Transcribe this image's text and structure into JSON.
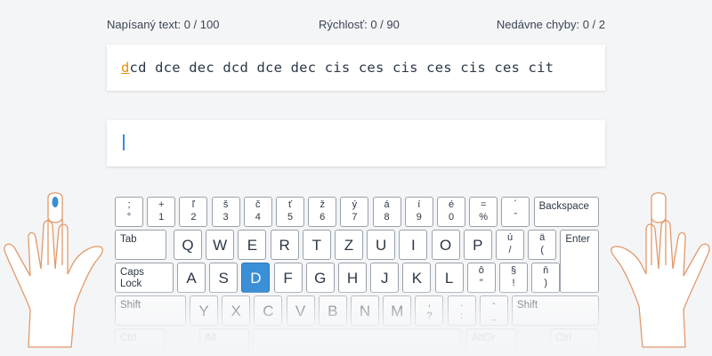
{
  "stats": {
    "typed": "Napísaný text: 0 / 100",
    "speed": "Rýchlosť: 0 / 90",
    "errors": "Nedávne chyby: 0 / 2"
  },
  "lesson": {
    "current_char": "d",
    "remaining_text": "cd dce dec dcd dce dec cis ces cis ces cis ces cit"
  },
  "input": {
    "value": ""
  },
  "colors": {
    "accent": "#3a8fd6",
    "current_char": "#e8930c",
    "finger_highlight": "#3a8fd6"
  },
  "hands": {
    "left_icon": "left-hand-icon",
    "right_icon": "right-hand-icon",
    "active_finger": "left-little"
  },
  "keyboard": {
    "row1": [
      {
        "top": ";",
        "bot": "°"
      },
      {
        "top": "+",
        "bot": "1"
      },
      {
        "top": "ľ",
        "bot": "2"
      },
      {
        "top": "š",
        "bot": "3"
      },
      {
        "top": "č",
        "bot": "4"
      },
      {
        "top": "ť",
        "bot": "5"
      },
      {
        "top": "ž",
        "bot": "6"
      },
      {
        "top": "ý",
        "bot": "7"
      },
      {
        "top": "á",
        "bot": "8"
      },
      {
        "top": "í",
        "bot": "9"
      },
      {
        "top": "é",
        "bot": "0"
      },
      {
        "top": "=",
        "bot": "%"
      },
      {
        "top": "´",
        "bot": "ˇ"
      }
    ],
    "backspace": "Backspace",
    "tab": "Tab",
    "row2": [
      "Q",
      "W",
      "E",
      "R",
      "T",
      "Z",
      "U",
      "I",
      "O",
      "P"
    ],
    "row2_extra": [
      {
        "top": "ú",
        "bot": "/"
      },
      {
        "top": "ä",
        "bot": "("
      }
    ],
    "enter": "Enter",
    "caps": "Caps\nLock",
    "row3": [
      "A",
      "S",
      "D",
      "F",
      "G",
      "H",
      "J",
      "K",
      "L"
    ],
    "row3_extra": [
      {
        "top": "ô",
        "bot": "\""
      },
      {
        "top": "§",
        "bot": "!"
      },
      {
        "top": "ň",
        "bot": ")"
      }
    ],
    "highlighted": "D",
    "shift": "Shift",
    "row4": [
      "Y",
      "X",
      "C",
      "V",
      "B",
      "N",
      "M"
    ],
    "row4_extra": [
      {
        "top": ",",
        "bot": "?"
      },
      {
        "top": ".",
        "bot": ":"
      },
      {
        "top": "-",
        "bot": "_"
      }
    ],
    "row5": [
      "Ctrl",
      "Alt",
      "AltGr",
      "Ctrl"
    ]
  }
}
